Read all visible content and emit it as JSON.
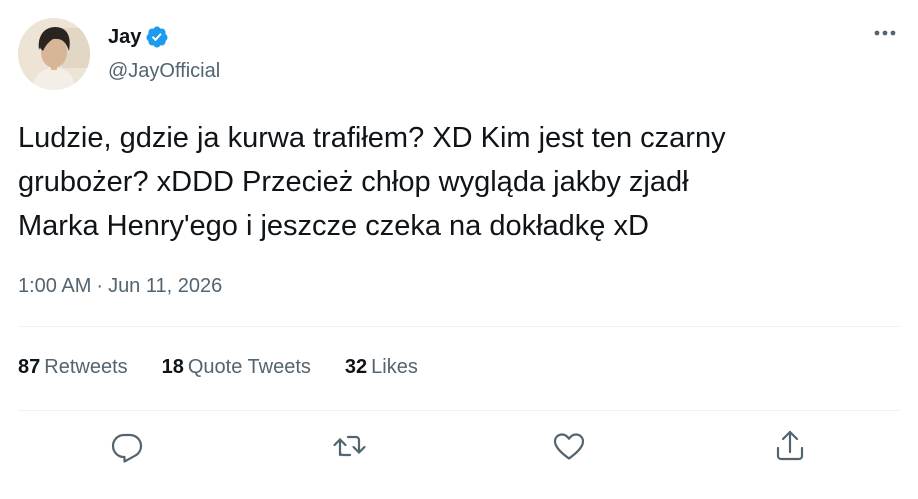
{
  "user": {
    "display_name": "Jay",
    "handle": "@JayOfficial",
    "verified_icon": "verified-badge-icon"
  },
  "tweet": {
    "text": "Ludzie, gdzie ja kurwa trafiłem? XD Kim jest ten czarny\ngrubożer? xDDD Przecież chłop wygląda jakby zjadł\nMarka Henry'ego i jeszcze czeka na dokładkę xD",
    "time": "1:00 AM",
    "separator": "·",
    "date": "Jun 11, 2026"
  },
  "stats": [
    {
      "count": "87",
      "label": "Retweets"
    },
    {
      "count": "18",
      "label": "Quote Tweets"
    },
    {
      "count": "32",
      "label": "Likes"
    }
  ],
  "actions": [
    "reply-icon",
    "retweet-icon",
    "like-icon",
    "share-icon"
  ],
  "colors": {
    "text": "#0f1419",
    "secondary": "#536471",
    "verified": "#1d9bf0",
    "divider": "#eff3f4"
  }
}
